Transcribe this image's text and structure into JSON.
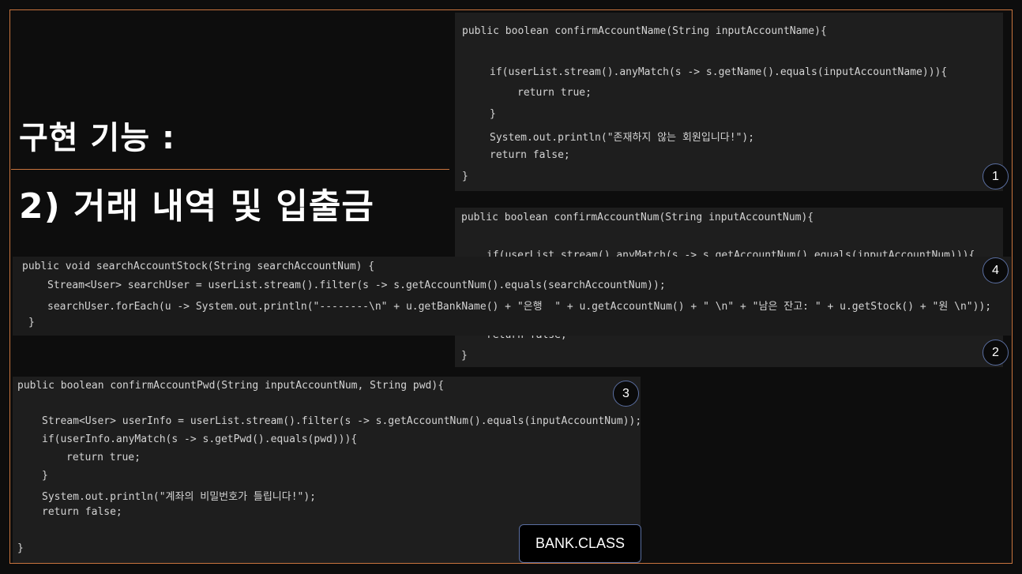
{
  "title": {
    "line1": "구현 기능 :",
    "line2": "2) 거래 내역 및 입출금"
  },
  "badges": [
    "1",
    "2",
    "3",
    "4"
  ],
  "footer_label": "BANK.CLASS",
  "snippet1": {
    "signature": "public boolean confirmAccountName(String inputAccountName){",
    "if_line": "if(userList.stream().anyMatch(s -> s.getName().equals(inputAccountName))){",
    "return_true": "return true;",
    "close_brace": "}",
    "println": "System.out.println(\"존재하지 않는 회원입니다!\");",
    "return_false": "return false;",
    "end_brace": "}"
  },
  "snippet2": {
    "signature": "public boolean confirmAccountNum(String inputAccountNum){",
    "partial_if": "if(userList.stream().anyMatch(s -> s.getAccountNum().equals(inputAccountNum))){",
    "return_false": "return false;",
    "end_brace": "}"
  },
  "snippet3": {
    "signature": "public boolean confirmAccountPwd(String inputAccountNum, String pwd){",
    "stream_line": "Stream<User> userInfo = userList.stream().filter(s -> s.getAccountNum().equals(inputAccountNum));",
    "if_line": "if(userInfo.anyMatch(s -> s.getPwd().equals(pwd))){",
    "return_true": "return true;",
    "close_brace": "}",
    "println": "System.out.println(\"계좌의 비밀번호가 틀립니다!\");",
    "return_false": "return false;",
    "end_brace": "}"
  },
  "snippet4": {
    "signature": "public void searchAccountStock(String searchAccountNum) {",
    "stream_line": "Stream<User> searchUser = userList.stream().filter(s -> s.getAccountNum().equals(searchAccountNum));",
    "foreach_line": "searchUser.forEach(u -> System.out.println(\"--------\\n\" + u.getBankName() + \"은행  \" + u.getAccountNum() + \" \\n\" + \"남은 잔고: \" + u.getStock() + \"원 \\n\"));",
    "end_brace": "}"
  }
}
